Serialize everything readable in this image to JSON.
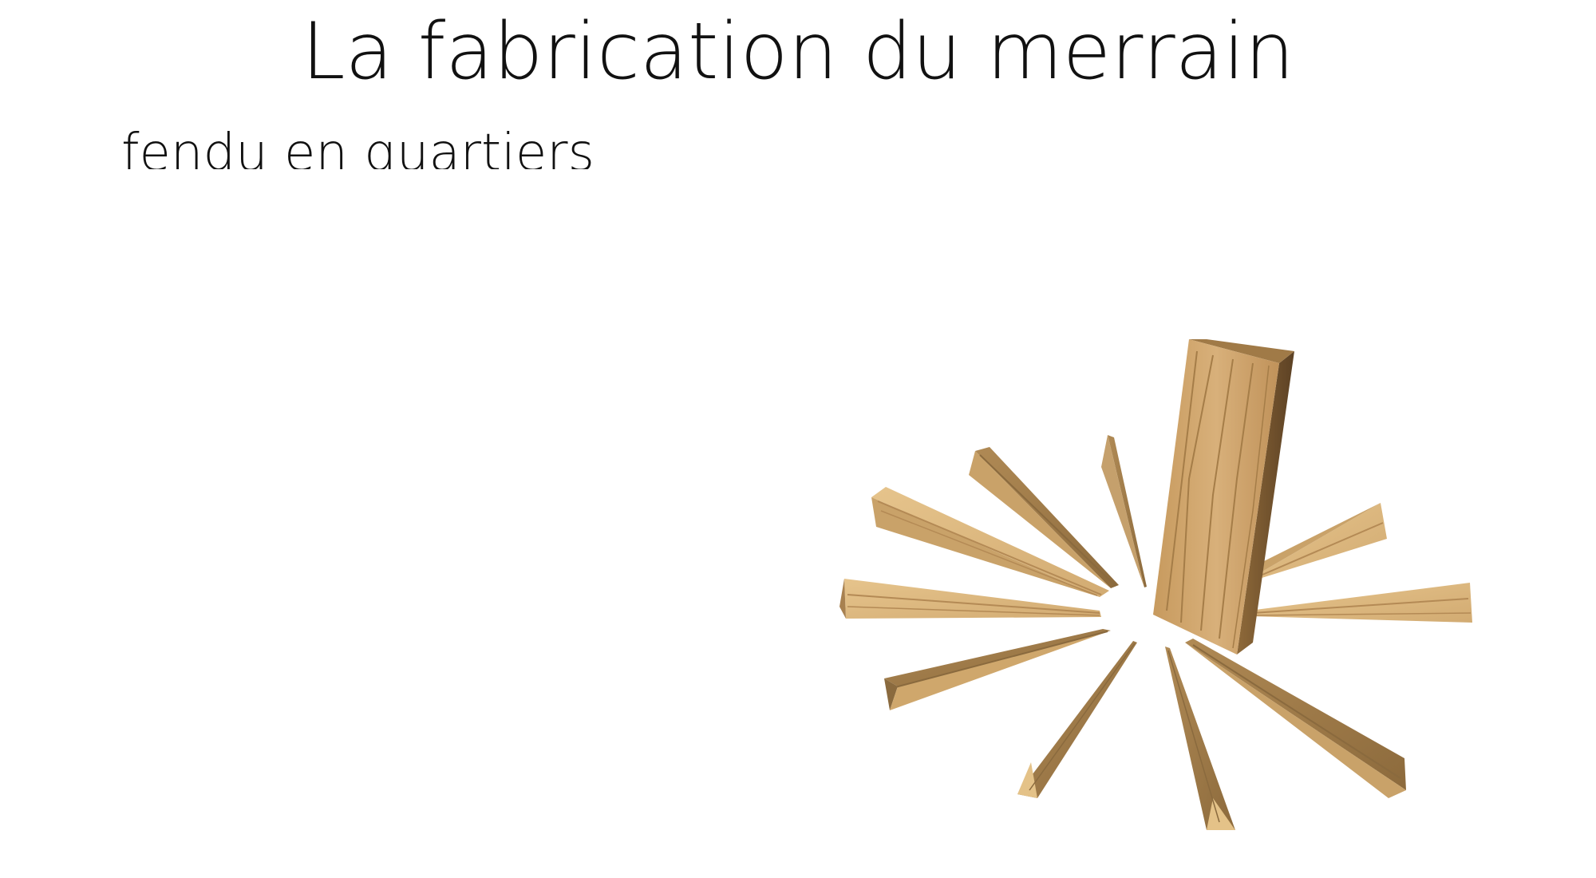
{
  "slide": {
    "title": "La fabrication du merrain",
    "subtitle": "fendu en quartiers"
  },
  "illustration": {
    "name": "split-log-with-wood-wedges",
    "colors": {
      "wood_light": "#e2bf87",
      "wood_mid": "#c9a56f",
      "wood_dark": "#8a6a3e",
      "wood_grain": "#b48a55"
    }
  }
}
